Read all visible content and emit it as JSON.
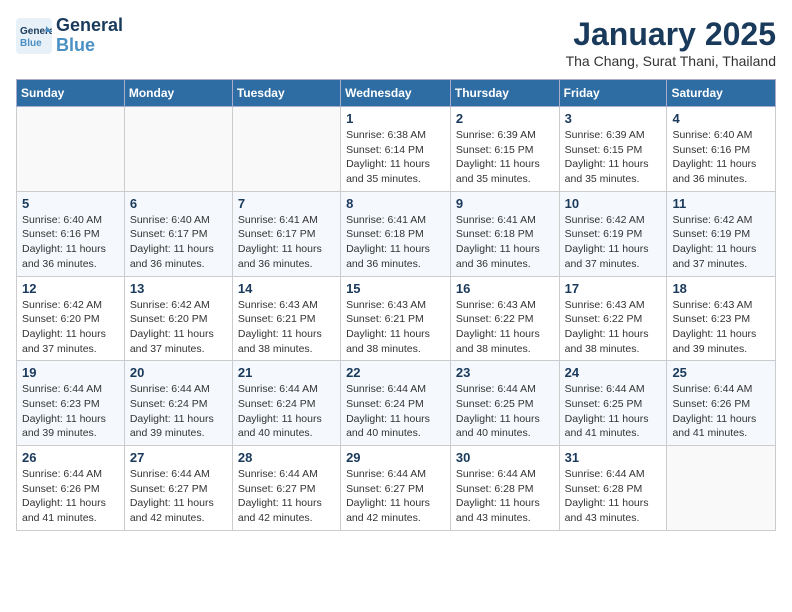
{
  "header": {
    "logo_line1": "General",
    "logo_line2": "Blue",
    "month_title": "January 2025",
    "subtitle": "Tha Chang, Surat Thani, Thailand"
  },
  "weekdays": [
    "Sunday",
    "Monday",
    "Tuesday",
    "Wednesday",
    "Thursday",
    "Friday",
    "Saturday"
  ],
  "weeks": [
    [
      {
        "day": "",
        "info": ""
      },
      {
        "day": "",
        "info": ""
      },
      {
        "day": "",
        "info": ""
      },
      {
        "day": "1",
        "info": "Sunrise: 6:38 AM\nSunset: 6:14 PM\nDaylight: 11 hours and 35 minutes."
      },
      {
        "day": "2",
        "info": "Sunrise: 6:39 AM\nSunset: 6:15 PM\nDaylight: 11 hours and 35 minutes."
      },
      {
        "day": "3",
        "info": "Sunrise: 6:39 AM\nSunset: 6:15 PM\nDaylight: 11 hours and 35 minutes."
      },
      {
        "day": "4",
        "info": "Sunrise: 6:40 AM\nSunset: 6:16 PM\nDaylight: 11 hours and 36 minutes."
      }
    ],
    [
      {
        "day": "5",
        "info": "Sunrise: 6:40 AM\nSunset: 6:16 PM\nDaylight: 11 hours and 36 minutes."
      },
      {
        "day": "6",
        "info": "Sunrise: 6:40 AM\nSunset: 6:17 PM\nDaylight: 11 hours and 36 minutes."
      },
      {
        "day": "7",
        "info": "Sunrise: 6:41 AM\nSunset: 6:17 PM\nDaylight: 11 hours and 36 minutes."
      },
      {
        "day": "8",
        "info": "Sunrise: 6:41 AM\nSunset: 6:18 PM\nDaylight: 11 hours and 36 minutes."
      },
      {
        "day": "9",
        "info": "Sunrise: 6:41 AM\nSunset: 6:18 PM\nDaylight: 11 hours and 36 minutes."
      },
      {
        "day": "10",
        "info": "Sunrise: 6:42 AM\nSunset: 6:19 PM\nDaylight: 11 hours and 37 minutes."
      },
      {
        "day": "11",
        "info": "Sunrise: 6:42 AM\nSunset: 6:19 PM\nDaylight: 11 hours and 37 minutes."
      }
    ],
    [
      {
        "day": "12",
        "info": "Sunrise: 6:42 AM\nSunset: 6:20 PM\nDaylight: 11 hours and 37 minutes."
      },
      {
        "day": "13",
        "info": "Sunrise: 6:42 AM\nSunset: 6:20 PM\nDaylight: 11 hours and 37 minutes."
      },
      {
        "day": "14",
        "info": "Sunrise: 6:43 AM\nSunset: 6:21 PM\nDaylight: 11 hours and 38 minutes."
      },
      {
        "day": "15",
        "info": "Sunrise: 6:43 AM\nSunset: 6:21 PM\nDaylight: 11 hours and 38 minutes."
      },
      {
        "day": "16",
        "info": "Sunrise: 6:43 AM\nSunset: 6:22 PM\nDaylight: 11 hours and 38 minutes."
      },
      {
        "day": "17",
        "info": "Sunrise: 6:43 AM\nSunset: 6:22 PM\nDaylight: 11 hours and 38 minutes."
      },
      {
        "day": "18",
        "info": "Sunrise: 6:43 AM\nSunset: 6:23 PM\nDaylight: 11 hours and 39 minutes."
      }
    ],
    [
      {
        "day": "19",
        "info": "Sunrise: 6:44 AM\nSunset: 6:23 PM\nDaylight: 11 hours and 39 minutes."
      },
      {
        "day": "20",
        "info": "Sunrise: 6:44 AM\nSunset: 6:24 PM\nDaylight: 11 hours and 39 minutes."
      },
      {
        "day": "21",
        "info": "Sunrise: 6:44 AM\nSunset: 6:24 PM\nDaylight: 11 hours and 40 minutes."
      },
      {
        "day": "22",
        "info": "Sunrise: 6:44 AM\nSunset: 6:24 PM\nDaylight: 11 hours and 40 minutes."
      },
      {
        "day": "23",
        "info": "Sunrise: 6:44 AM\nSunset: 6:25 PM\nDaylight: 11 hours and 40 minutes."
      },
      {
        "day": "24",
        "info": "Sunrise: 6:44 AM\nSunset: 6:25 PM\nDaylight: 11 hours and 41 minutes."
      },
      {
        "day": "25",
        "info": "Sunrise: 6:44 AM\nSunset: 6:26 PM\nDaylight: 11 hours and 41 minutes."
      }
    ],
    [
      {
        "day": "26",
        "info": "Sunrise: 6:44 AM\nSunset: 6:26 PM\nDaylight: 11 hours and 41 minutes."
      },
      {
        "day": "27",
        "info": "Sunrise: 6:44 AM\nSunset: 6:27 PM\nDaylight: 11 hours and 42 minutes."
      },
      {
        "day": "28",
        "info": "Sunrise: 6:44 AM\nSunset: 6:27 PM\nDaylight: 11 hours and 42 minutes."
      },
      {
        "day": "29",
        "info": "Sunrise: 6:44 AM\nSunset: 6:27 PM\nDaylight: 11 hours and 42 minutes."
      },
      {
        "day": "30",
        "info": "Sunrise: 6:44 AM\nSunset: 6:28 PM\nDaylight: 11 hours and 43 minutes."
      },
      {
        "day": "31",
        "info": "Sunrise: 6:44 AM\nSunset: 6:28 PM\nDaylight: 11 hours and 43 minutes."
      },
      {
        "day": "",
        "info": ""
      }
    ]
  ]
}
